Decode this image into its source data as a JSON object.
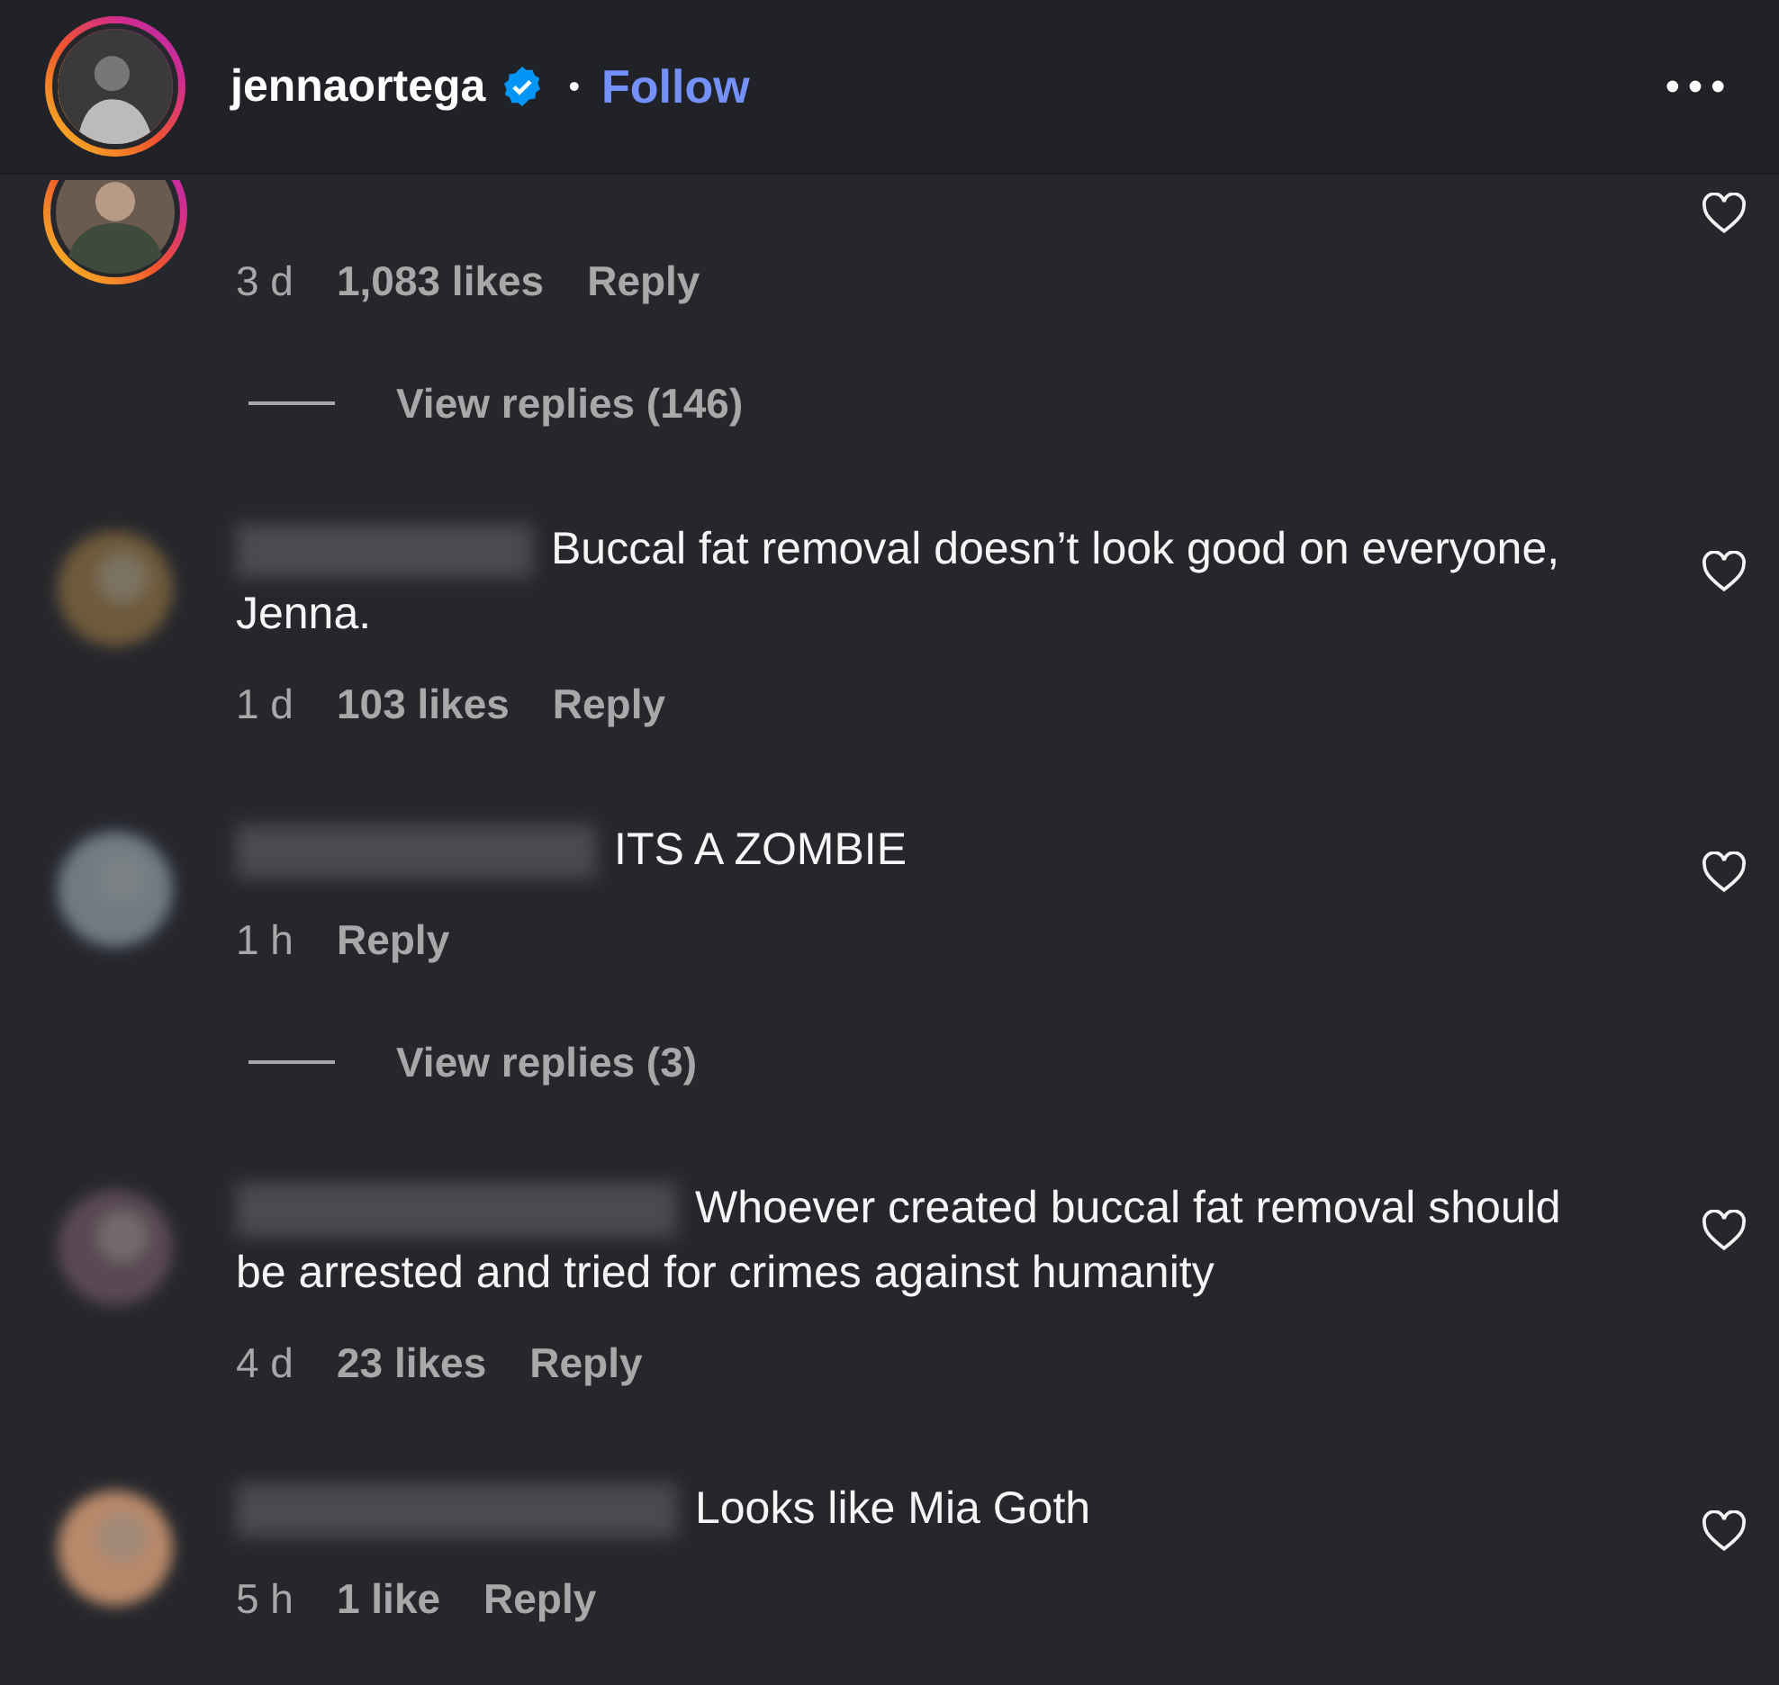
{
  "header": {
    "username": "jennaortega",
    "verified": true,
    "separator": "•",
    "follow": "Follow"
  },
  "comments": [
    {
      "story_ring": true,
      "meta": [
        "3 d",
        "1,083 likes"
      ],
      "reply": "Reply",
      "view_replies": "View replies (146)"
    },
    {
      "story_ring": false,
      "text": "Buccal fat removal doesn’t look good on everyone, Jenna.",
      "meta": [
        "1 d",
        "103 likes"
      ],
      "reply": "Reply"
    },
    {
      "story_ring": false,
      "text": "ITS A ZOMBIE",
      "meta": [
        "1 h"
      ],
      "reply": "Reply",
      "view_replies": "View replies (3)"
    },
    {
      "story_ring": false,
      "text": "Whoever created buccal fat removal should be arrested and tried for crimes against humanity",
      "meta": [
        "4 d",
        "23 likes"
      ],
      "reply": "Reply"
    },
    {
      "story_ring": false,
      "text": "Looks like Mia Goth",
      "meta": [
        "5 h",
        "1 like"
      ],
      "reply": "Reply"
    }
  ]
}
